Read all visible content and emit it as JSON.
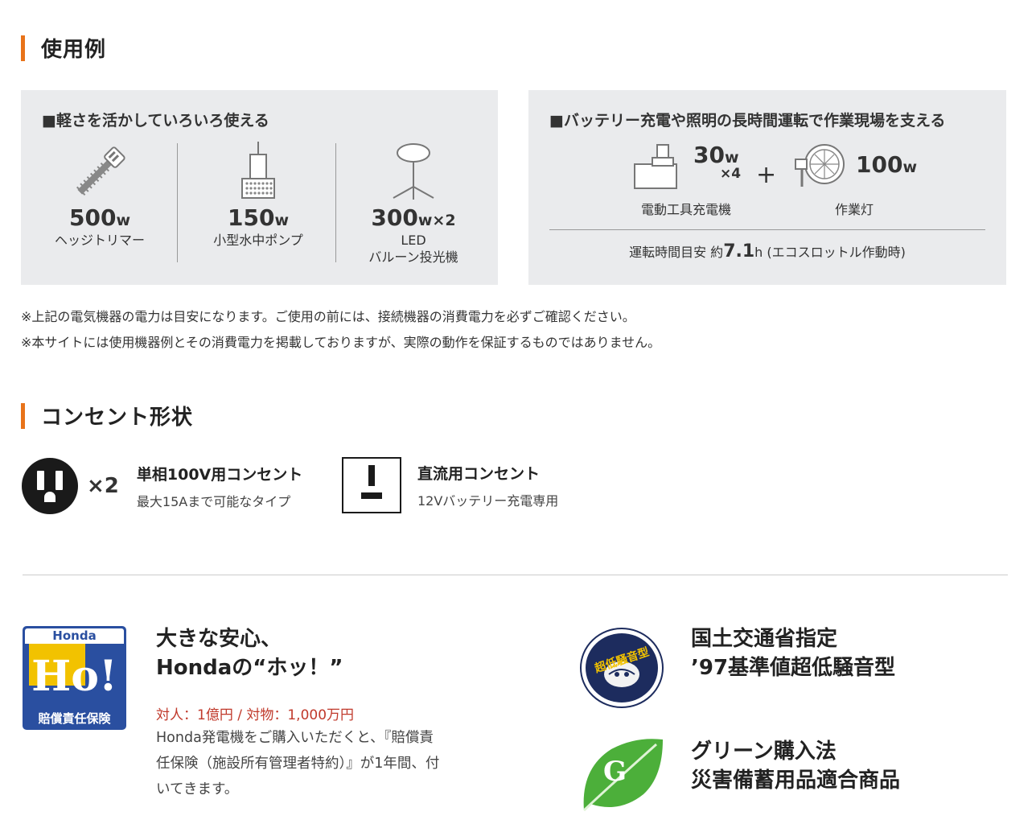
{
  "section1": {
    "title": "使用例"
  },
  "left_panel": {
    "heading": "■軽さを活かしていろいろ使える",
    "devices": [
      {
        "icon": "hedge-trimmer-icon",
        "watt": "500",
        "unit": "w",
        "name": "ヘッジトリマー"
      },
      {
        "icon": "water-pump-icon",
        "watt": "150",
        "unit": "w",
        "name": "小型水中ポンプ"
      },
      {
        "icon": "balloon-light-icon",
        "watt": "300",
        "unit": "w×2",
        "name_line1": "LED",
        "name_line2": "バルーン投光機"
      }
    ]
  },
  "right_panel": {
    "heading": "■バッテリー充電や照明の長時間運転で作業現場を支える",
    "charger": {
      "watt": "30",
      "unit": "w",
      "multiplier": "×4",
      "name": "電動工具充電機"
    },
    "plus": "+",
    "light": {
      "watt": "100",
      "unit": "w",
      "name": "作業灯"
    },
    "runtime_prefix": "運転時間目安 約",
    "runtime_value": "7.1",
    "runtime_unit": "h",
    "runtime_suffix": "(エコスロットル作動時)"
  },
  "notes": [
    "※上記の電気機器の電力は目安になります。ご使用の前には、接続機器の消費電力を必ずご確認ください。",
    "※本サイトには使用機器例とその消費電力を掲載しておりますが、実際の動作を保証するものではありません。"
  ],
  "section2": {
    "title": "コンセント形状"
  },
  "outlets": [
    {
      "icon": "ac-outlet-icon",
      "count": "×2",
      "title": "単相100V用コンセント",
      "sub": "最大15Aまで可能なタイプ"
    },
    {
      "icon": "dc-outlet-icon",
      "title": "直流用コンセント",
      "sub": "12Vバッテリー充電専用"
    }
  ],
  "features": {
    "honda": {
      "badge_top": "Honda",
      "badge_big": "Ho!",
      "badge_bottom": "賠償責任保険",
      "title_line1": "大きな安心、",
      "title_line2": "Hondaの“ホッ！”",
      "coverage": "対人：1億円 / 対物：1,000万円",
      "body_line1": "Honda発電機をご購入いただくと、『賠償責",
      "body_line2": "任保険（施設所有管理者特約）』が1年間、付",
      "body_line3": "いてきます。"
    },
    "mlit": {
      "badge_text": "超低騒音型",
      "title_line1": "国土交通省指定",
      "title_line2": "’97基準値超低騒音型"
    },
    "green": {
      "badge_letter": "G",
      "title_line1": "グリーン購入法",
      "title_line2": "災害備蓄用品適合商品"
    }
  },
  "colors": {
    "accent": "#e8731a",
    "panel": "#eaebed",
    "red": "#c0392b",
    "honda_blue": "#2a4fa0",
    "mlit_navy": "#1d2c5e",
    "green": "#4caf3a"
  }
}
